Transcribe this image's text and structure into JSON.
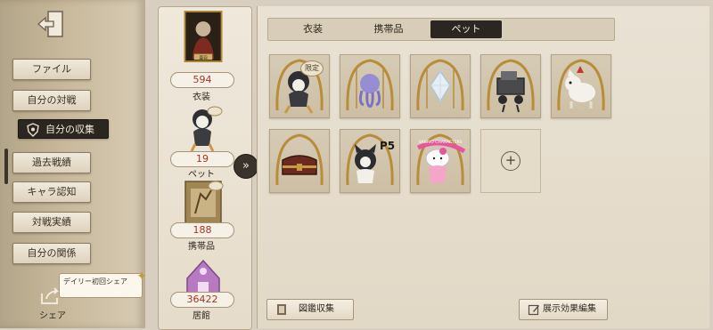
{
  "sidebar": {
    "menu": [
      {
        "label": "ファイル"
      },
      {
        "label": "自分の対戦"
      },
      {
        "label": "自分の収集",
        "active": true
      },
      {
        "label": "過去戦績"
      },
      {
        "label": "キャラ認知"
      },
      {
        "label": "対戦実績"
      },
      {
        "label": "自分の関係"
      }
    ],
    "daily_share": "デイリー初回シェア",
    "share_label": "シェア"
  },
  "summary": [
    {
      "count": "594",
      "label": "衣装",
      "icon": "costume-card-icon"
    },
    {
      "count": "19",
      "label": "ペット",
      "icon": "pet-figure-icon"
    },
    {
      "count": "188",
      "label": "携帯品",
      "icon": "accessory-icon"
    },
    {
      "count": "36422",
      "label": "居館",
      "icon": "residence-icon"
    }
  ],
  "summary_thumb_text": {
    "costume_card": "亜羽"
  },
  "tabs": [
    {
      "label": "衣装"
    },
    {
      "label": "携帯品"
    },
    {
      "label": "ペット",
      "active": true
    }
  ],
  "pets": [
    {
      "icon": "penguin-pet-icon",
      "badge": "限定"
    },
    {
      "icon": "octopus-pet-icon"
    },
    {
      "icon": "crystal-pet-icon"
    },
    {
      "icon": "robot-pet-icon"
    },
    {
      "icon": "dog-pet-icon"
    },
    {
      "icon": "chest-pet-icon"
    },
    {
      "icon": "persona-cat-pet-icon",
      "logo": "P5"
    },
    {
      "icon": "kitty-pet-icon",
      "logo": "SANRIO CHARACTERS"
    }
  ],
  "add_label": "+",
  "buttons": {
    "catalog": "図鑑収集",
    "display_edit": "展示効果編集"
  },
  "colors": {
    "accent_dark": "#2b2621",
    "count_red": "#a4342a",
    "paper": "#e9e2d4"
  }
}
